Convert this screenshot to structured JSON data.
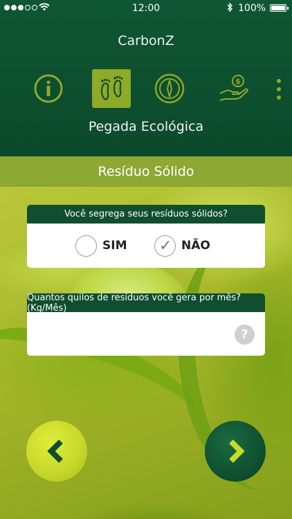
{
  "status_bar": {
    "time": "12:00",
    "battery": "100%",
    "bluetooth_icon": "bluetooth-icon",
    "wifi_icon": "wifi-icon"
  },
  "header": {
    "app_title": "CarbonZ",
    "section_title": "Pegada Ecológica",
    "nav_icons": [
      {
        "name": "info-icon",
        "active": false
      },
      {
        "name": "footprint-icon",
        "active": true
      },
      {
        "name": "compass-icon",
        "active": false
      },
      {
        "name": "money-hand-icon",
        "active": false
      }
    ],
    "more_icon": "more-vertical-icon"
  },
  "subheader": {
    "title": "Resíduo Sólido"
  },
  "question1": {
    "text": "Você segrega seus resíduos sólidos?",
    "options": [
      "SIM",
      "NÃO"
    ],
    "selected": "NÃO"
  },
  "question2": {
    "text": "Quantos quilos de resíduos você gera por mês? (Kg/Mês)",
    "value": "",
    "help": "?"
  },
  "navigation": {
    "prev_icon": "chevron-left-icon",
    "next_icon": "chevron-right-icon"
  },
  "colors": {
    "header_green": "#0f5634",
    "accent_lime": "#8ea834",
    "card_header": "#0f4e2f",
    "prev_button": "#c8d92b",
    "next_button": "#0f5131"
  }
}
